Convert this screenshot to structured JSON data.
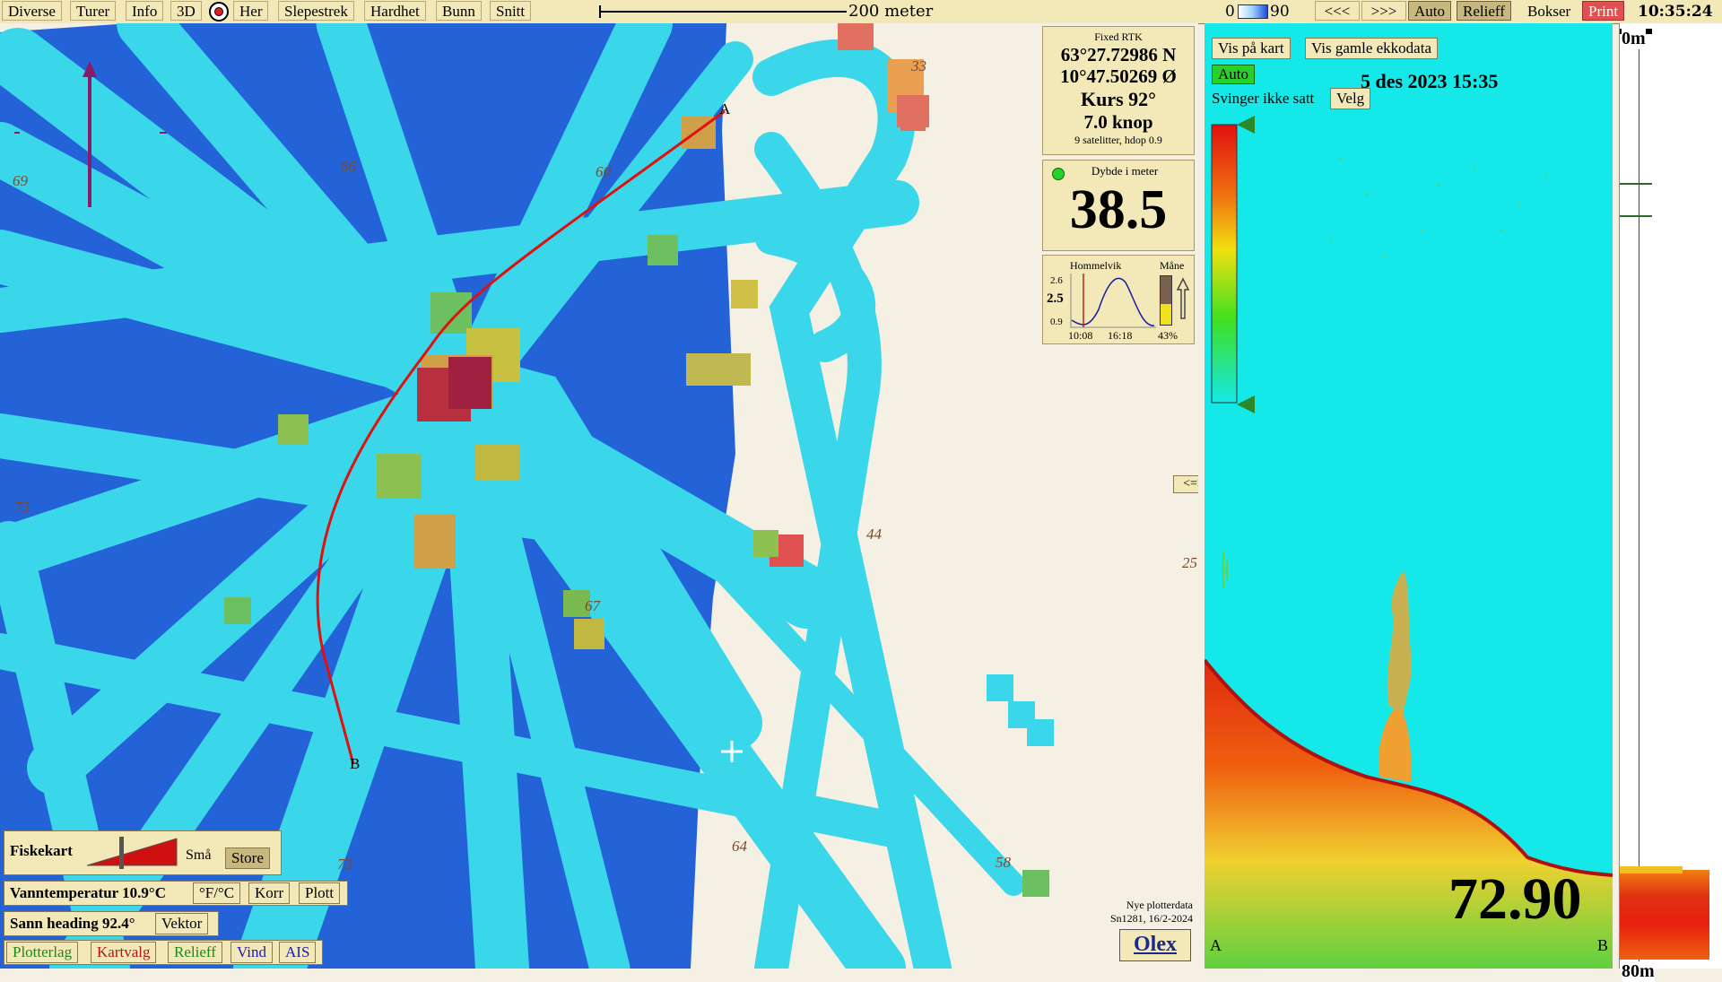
{
  "menu": {
    "items": [
      "Diverse",
      "Turer",
      "Info",
      "3D"
    ],
    "her": "Her",
    "items2": [
      "Slepestrek",
      "Hardhet",
      "Bunn",
      "Snitt"
    ],
    "scale_label": "200 meter",
    "range_min": "0",
    "range_max": "90",
    "prev": "<<<",
    "next": ">>>",
    "auto": "Auto",
    "relieff": "Relieff",
    "bokser": "Bokser",
    "print": "Print",
    "clock": "10:35:24"
  },
  "gps": {
    "fix": "Fixed RTK",
    "lat": "63°27.72986 N",
    "lon": "10°47.50269 Ø",
    "course": "Kurs 92°",
    "speed": "7.0 knop",
    "sats": "9 satelitter, hdop 0.9"
  },
  "depth": {
    "label": "Dybde i meter",
    "value": "38.5"
  },
  "tide": {
    "place": "Hommelvik",
    "moon": "Måne",
    "max": "2.6",
    "cur": "2.5",
    "min": "0.9",
    "t1": "10:08",
    "t2": "16:18",
    "moon_pct": "43%",
    "moon_fill": 0.43
  },
  "map_labels": {
    "depths": [
      "69",
      "66",
      "60",
      "33",
      "73",
      "44",
      "25",
      "67",
      "73",
      "64",
      "58"
    ],
    "point_a": "A",
    "point_b": "B",
    "note1": "Nye plotterdata",
    "note2": "Sn1281, 16/2-2024",
    "brand": "Olex",
    "swap": "<=>"
  },
  "bottom_panel": {
    "fiskekart": "Fiskekart",
    "sma": "Små",
    "store": "Store",
    "water_temp": "Vanntemperatur 10.9°C",
    "units": "°F/°C",
    "korr": "Korr",
    "plott": "Plott",
    "heading": "Sann heading 92.4°",
    "vektor": "Vektor",
    "tabs": [
      {
        "label": "Plotterlag",
        "color": "#1a8a1a"
      },
      {
        "label": "Kartvalg",
        "color": "#b01818"
      },
      {
        "label": "Relieff",
        "color": "#1a8a1a"
      },
      {
        "label": "Vind",
        "color": "#1a1ab0"
      },
      {
        "label": "AIS",
        "color": "#1a1ab0"
      }
    ]
  },
  "echo": {
    "vis_pa_kart": "Vis på kart",
    "vis_gamle": "Vis gamle ekkodata",
    "auto": "Auto",
    "date": "5 des 2023 15:35",
    "transducer": "Svinger ikke satt",
    "velg": "Velg",
    "depth_readout": "72.90",
    "corner_a": "A",
    "corner_b": "B",
    "scale_top": "0m",
    "scale_bottom": "80m"
  },
  "colors": {
    "deep_blue": "#2462d8",
    "cyan": "#3ad6ea",
    "track_red": "#e01010",
    "panel": "#f2e8b8"
  }
}
